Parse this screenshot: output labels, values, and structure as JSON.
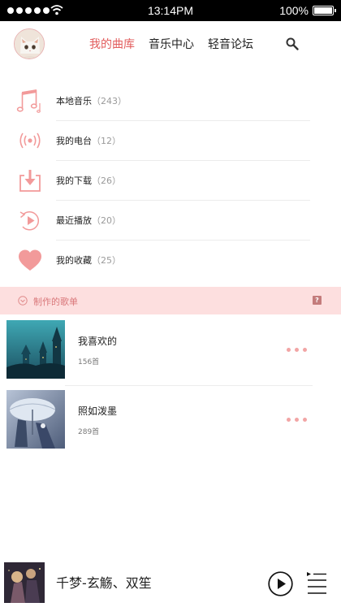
{
  "status_bar": {
    "time": "13:14PM",
    "battery_percent": "100%",
    "signal_bars": 5,
    "icons": [
      "signal-dots",
      "wifi-icon",
      "battery-icon"
    ]
  },
  "header": {
    "tabs": [
      {
        "label": "我的曲库",
        "active": true
      },
      {
        "label": "音乐中心",
        "active": false
      },
      {
        "label": "轻音论坛",
        "active": false
      }
    ],
    "icons": [
      "avatar-cat",
      "search-icon"
    ]
  },
  "menu": [
    {
      "label": "本地音乐",
      "count": "（243）",
      "icon": "music-note-icon"
    },
    {
      "label": "我的电台",
      "count": "（12）",
      "icon": "radio-icon"
    },
    {
      "label": "我的下载",
      "count": "（26）",
      "icon": "download-icon"
    },
    {
      "label": "最近播放",
      "count": "（20）",
      "icon": "recent-play-icon"
    },
    {
      "label": "我的收藏",
      "count": "（25）",
      "icon": "heart-icon"
    }
  ],
  "section": {
    "title": "制作的歌单",
    "help_label": "?"
  },
  "playlists": [
    {
      "name": "我喜欢的",
      "count": "156首",
      "cover": "castle-cover"
    },
    {
      "name": "照如泼墨",
      "count": "289首",
      "cover": "umbrella-cover"
    }
  ],
  "player": {
    "title": "千梦",
    "artist": "-玄觞、双笙",
    "icons": [
      "play-icon",
      "queue-icon"
    ]
  },
  "colors": {
    "accent": "#e25c5c",
    "icon_pink": "#f29a9a",
    "section_bg": "#fddfdf",
    "more_dots": "#f2a5a5"
  }
}
